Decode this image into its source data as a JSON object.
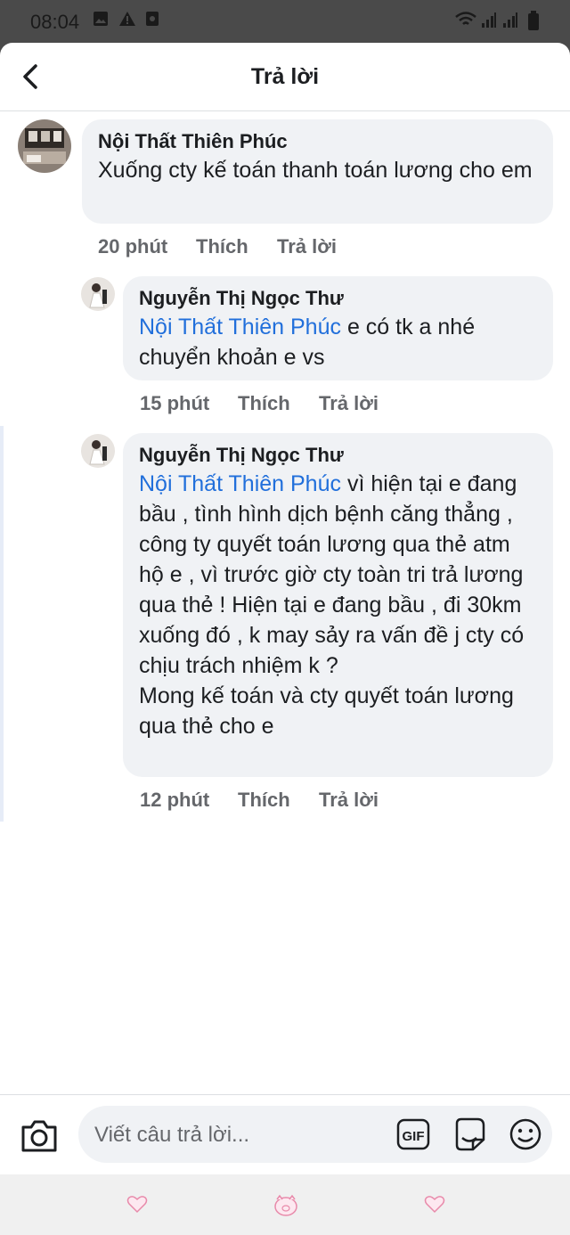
{
  "status_bar": {
    "time": "08:04"
  },
  "header": {
    "title": "Trả lời"
  },
  "comments": [
    {
      "author": "Nội Thất Thiên Phúc",
      "mention": "",
      "text": "Xuống cty kế toán thanh toán lương cho em",
      "time": "20 phút",
      "like": "Thích",
      "reply": "Trả lời"
    },
    {
      "author": "Nguyễn Thị Ngọc Thư",
      "mention": "Nội Thất Thiên Phúc",
      "text": " e có tk a nhé chuyển khoản e vs",
      "time": "15 phút",
      "like": "Thích",
      "reply": "Trả lời"
    },
    {
      "author": "Nguyễn Thị Ngọc Thư",
      "mention": "Nội Thất Thiên Phúc",
      "text": " vì hiện tại e đang bầu , tình hình dịch bệnh căng thẳng , công ty quyết toán lương qua thẻ atm hộ e , vì trước giờ cty toàn tri trả lương qua thẻ ! Hiện tại e đang bầu , đi 30km xuống đó , k may sảy ra vấn đề j cty có chịu trách nhiệm k ?",
      "text2": "Mong kế toán và cty quyết toán lương qua thẻ cho e",
      "time": "12 phút",
      "like": "Thích",
      "reply": "Trả lời"
    }
  ],
  "composer": {
    "placeholder": "Viết câu trả lời..."
  },
  "colors": {
    "mention": "#216fdb",
    "bubble": "#f0f2f5",
    "meta": "#65676b"
  }
}
